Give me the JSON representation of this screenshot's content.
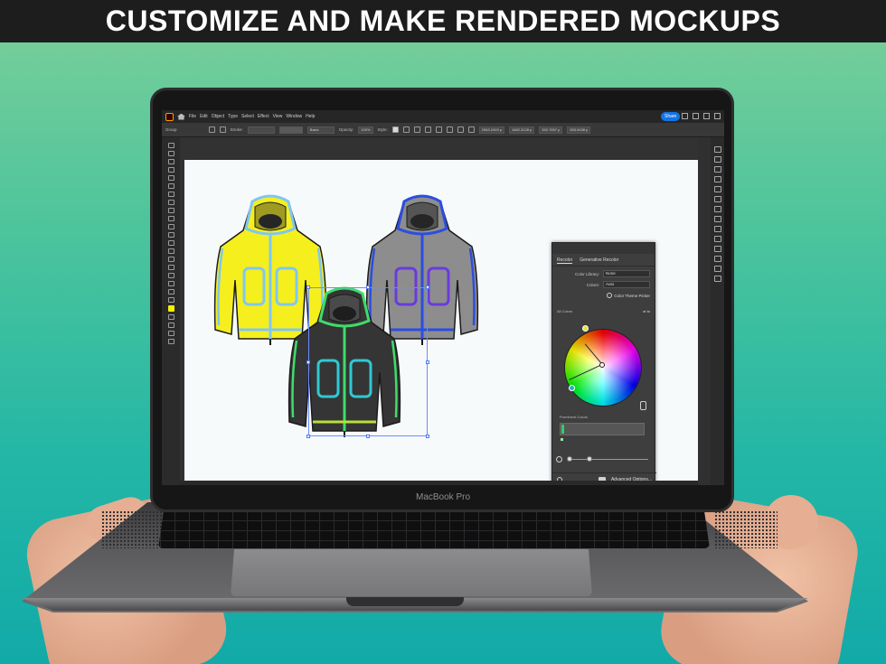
{
  "banner": {
    "title": "CUSTOMIZE AND MAKE RENDERED MOCKUPS"
  },
  "laptop": {
    "brand": "MacBook Pro"
  },
  "app": {
    "menu": [
      "File",
      "Edit",
      "Object",
      "Type",
      "Select",
      "Effect",
      "View",
      "Window",
      "Help"
    ],
    "share_label": "Share",
    "control_bar": {
      "group_label": "Group",
      "stroke_label": "Stroke:",
      "stroke_style": "Basic",
      "opacity_label": "Opacity:",
      "opacity_value": "100%",
      "style_label": "Style:",
      "x_value": "2963.2403 p",
      "y_value": "1662.3128 p",
      "w_value": "392.7057 p",
      "h_value": "553.9438 p"
    }
  },
  "artwork": {
    "colors": {
      "yellow_body": "#f5ef1e",
      "yellow_trim": "#7ec7f2",
      "gray_body": "#8d8d8d",
      "gray_trim": "#2c4de0",
      "black_body": "#353535",
      "black_trim": "#3fdc6a",
      "outline": "#1b1b1b",
      "accent": "#1473e6"
    }
  },
  "recolor_panel": {
    "tab_recolor": "Recolor",
    "tab_generative": "Generative Recolor",
    "color_library_label": "Color Library:",
    "color_library_value": "None",
    "colors_label": "Colors:",
    "colors_value": "Auto",
    "theme_picker": "Color Theme Picker",
    "all_colors_label": "All Colors",
    "prominent_label": "Prominent Colors",
    "advanced_options": "Advanced Options..."
  }
}
